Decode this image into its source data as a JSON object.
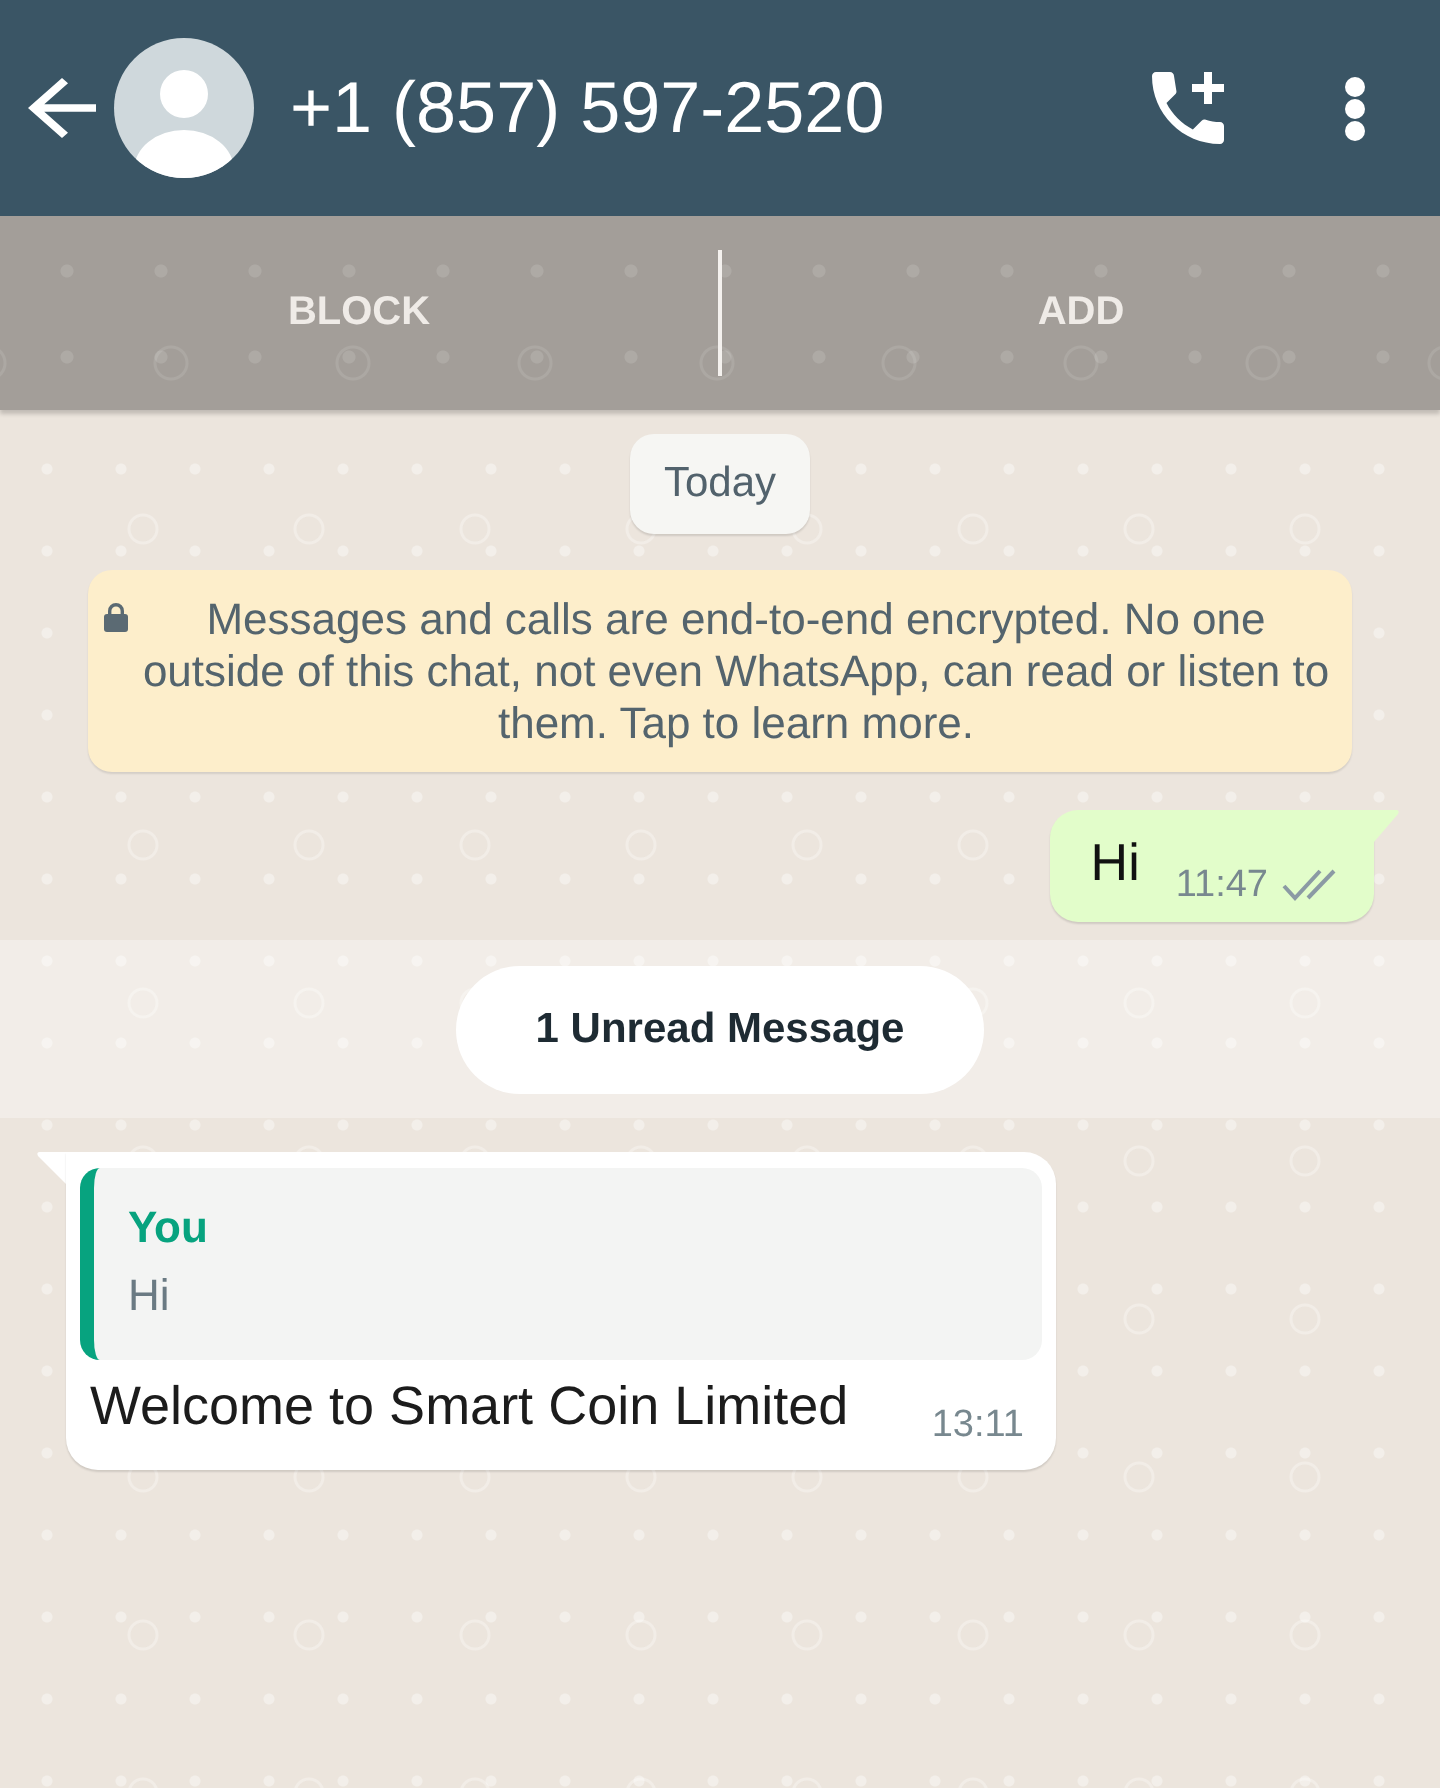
{
  "header": {
    "title": "+1 (857) 597-2520"
  },
  "actions": [
    {
      "label": "BLOCK"
    },
    {
      "label": "ADD"
    }
  ],
  "messages": [
    {
      "kind": "date",
      "text": "Today"
    },
    {
      "kind": "notice",
      "text": "Messages and calls are end-to-end encrypted. No one outside of this chat, not even WhatsApp, can read or listen to them. Tap to learn more."
    },
    {
      "kind": "outgoing",
      "text": "Hi",
      "time": "11:47",
      "read": false
    },
    {
      "kind": "unread",
      "text": "1 Unread Message"
    },
    {
      "kind": "incoming",
      "quote": {
        "author": "You",
        "text": "Hi"
      },
      "text": "Welcome to Smart Coin Limited",
      "time": "13:11"
    }
  ]
}
